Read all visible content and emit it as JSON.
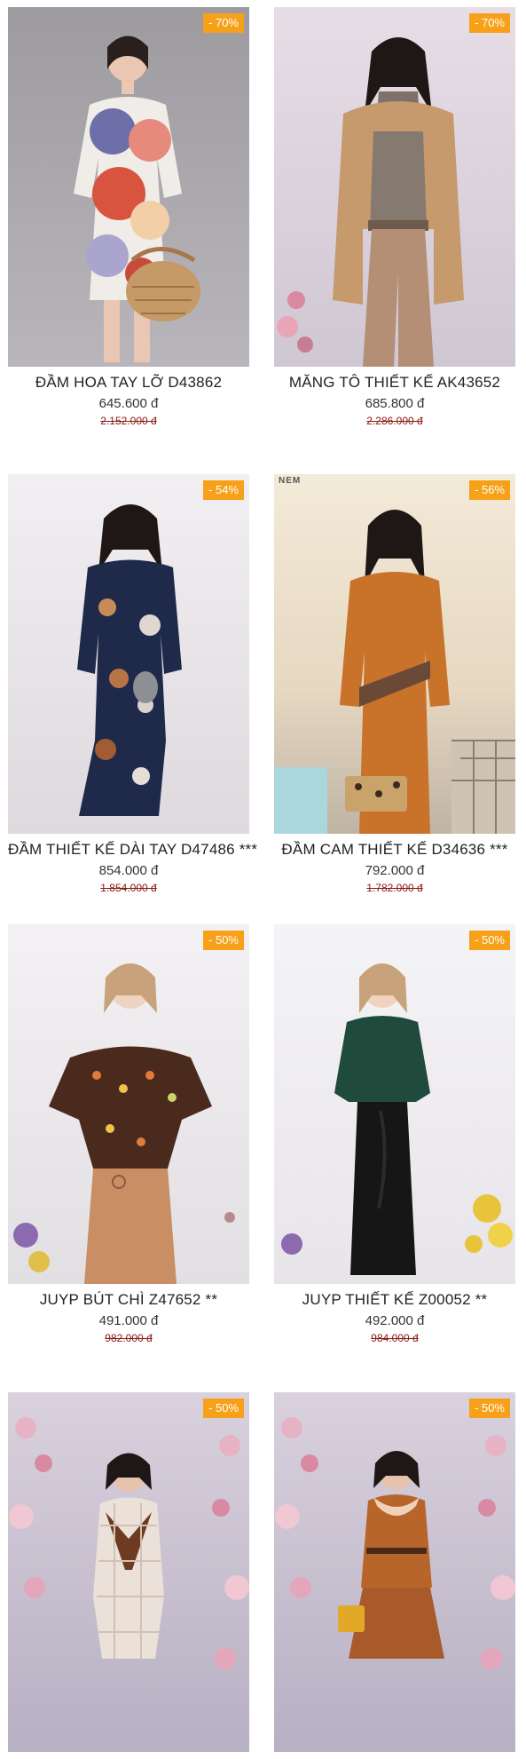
{
  "products": [
    {
      "name": "ĐẦM HOA TAY LỠ D43862",
      "price": "645.600 đ",
      "old_price": "2.152.000 đ",
      "discount": "- 70%"
    },
    {
      "name": "MĂNG TÔ THIẾT KẾ AK43652",
      "price": "685.800 đ",
      "old_price": "2.286.000 đ",
      "discount": "- 70%"
    },
    {
      "name": "ĐẦM THIẾT KẾ DÀI TAY D47486 ***",
      "price": "854.000 đ",
      "old_price": "1.854.000 đ",
      "discount": "- 54%"
    },
    {
      "name": "ĐẦM CAM THIẾT KẾ D34636 ***",
      "price": "792.000 đ",
      "old_price": "1.782.000 đ",
      "discount": "- 56%",
      "brand_mark": "NEM"
    },
    {
      "name": "JUYP BÚT CHÌ Z47652 **",
      "price": "491.000 đ",
      "old_price": "982.000 đ",
      "discount": "- 50%"
    },
    {
      "name": "JUYP THIẾT KẾ Z00052 **",
      "price": "492.000 đ",
      "old_price": "984.000 đ",
      "discount": "- 50%"
    },
    {
      "name": "",
      "price": "",
      "old_price": "",
      "discount": "- 50%"
    },
    {
      "name": "",
      "price": "",
      "old_price": "",
      "discount": "- 50%"
    }
  ],
  "colors": {
    "badge": "#f7a11a",
    "old_price": "#8a1a12"
  }
}
